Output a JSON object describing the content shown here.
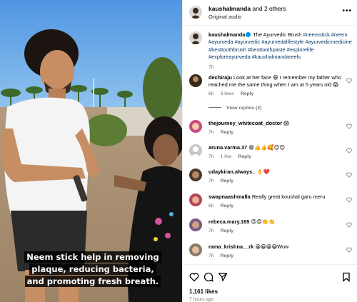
{
  "header": {
    "username": "kaushalmanda",
    "others": " and 2 others",
    "audio": "Original audio",
    "more_icon": "more-dots-icon"
  },
  "video": {
    "caption": "Neem stick help in removing plaque, reducing bacteria, and promoting fresh breath."
  },
  "post_caption": {
    "username": "kaushalmanda",
    "text_prefix": " The Ayurvedic Brush ",
    "hashtags": "#neemstick #neem #ayurveda #ayurvedic #ayurvedalifestyle #ayurvedicmedicine #besttoothbrush #besttoothpaste #explorelife #exploreayurveda #kaushalmandareels",
    "time": "7h"
  },
  "comments": [
    {
      "username": "dechiraju",
      "text": "Look at her face 😆 I remember my father who reached me the same thing when I am at 5 years old 😱",
      "time": "6h",
      "likes": "3 likes",
      "reply": "Reply",
      "avatar_color": "#3a2a1c"
    },
    {
      "username": "thejourney_whitecoat_doctor",
      "text": "😱",
      "time": "7h",
      "likes": "",
      "reply": "Reply",
      "avatar_color": "#c84a82"
    },
    {
      "username": "aruna.varma.37",
      "text": "😄👍👍🥰😊😊",
      "time": "7h",
      "likes": "1 like",
      "reply": "Reply",
      "avatar_color": "#c7c7c7"
    },
    {
      "username": "udaykiran.always_",
      "text": "👌❤️",
      "time": "7h",
      "likes": "",
      "reply": "Reply",
      "avatar_color": "#4a3a2a"
    },
    {
      "username": "swapnaashmalla",
      "text": "Really great koushal garu meru",
      "time": "6h",
      "likes": "",
      "reply": "Reply",
      "avatar_color": "#b8445a"
    },
    {
      "username": "rebeca.mary.165",
      "text": "😍😍👏👏",
      "time": "7h",
      "likes": "",
      "reply": "Reply",
      "avatar_color": "#7a5a8a"
    },
    {
      "username": "rama_krishna__rk",
      "text": "😀😀😀😀Wow",
      "time": "7h",
      "likes": "",
      "reply": "Reply",
      "avatar_color": "#8a7a6a"
    }
  ],
  "view_replies": "View replies (2)",
  "actions": {
    "like_icon": "heart-icon",
    "comment_icon": "comment-icon",
    "share_icon": "send-icon",
    "likes": "1,161 likes",
    "posted": "7 hours ago"
  }
}
